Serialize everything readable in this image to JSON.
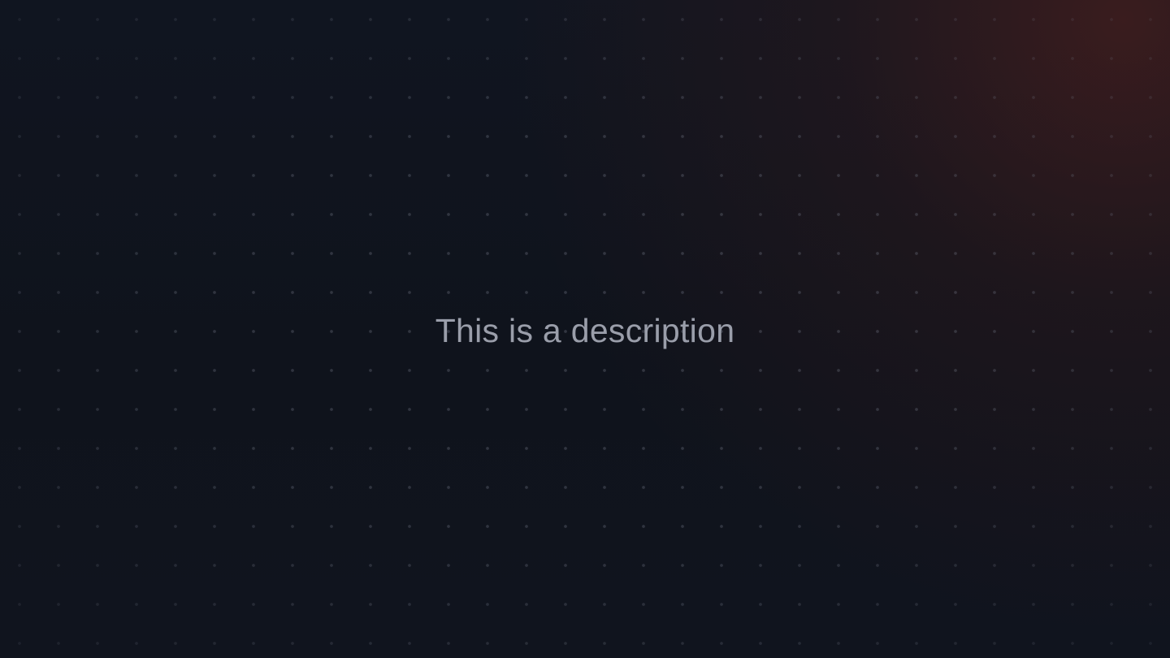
{
  "background": {
    "base_color": "#0f131c",
    "accent_glow_color": "#5c221c",
    "dot_color": "#737887"
  },
  "main": {
    "description": "This is a description"
  }
}
